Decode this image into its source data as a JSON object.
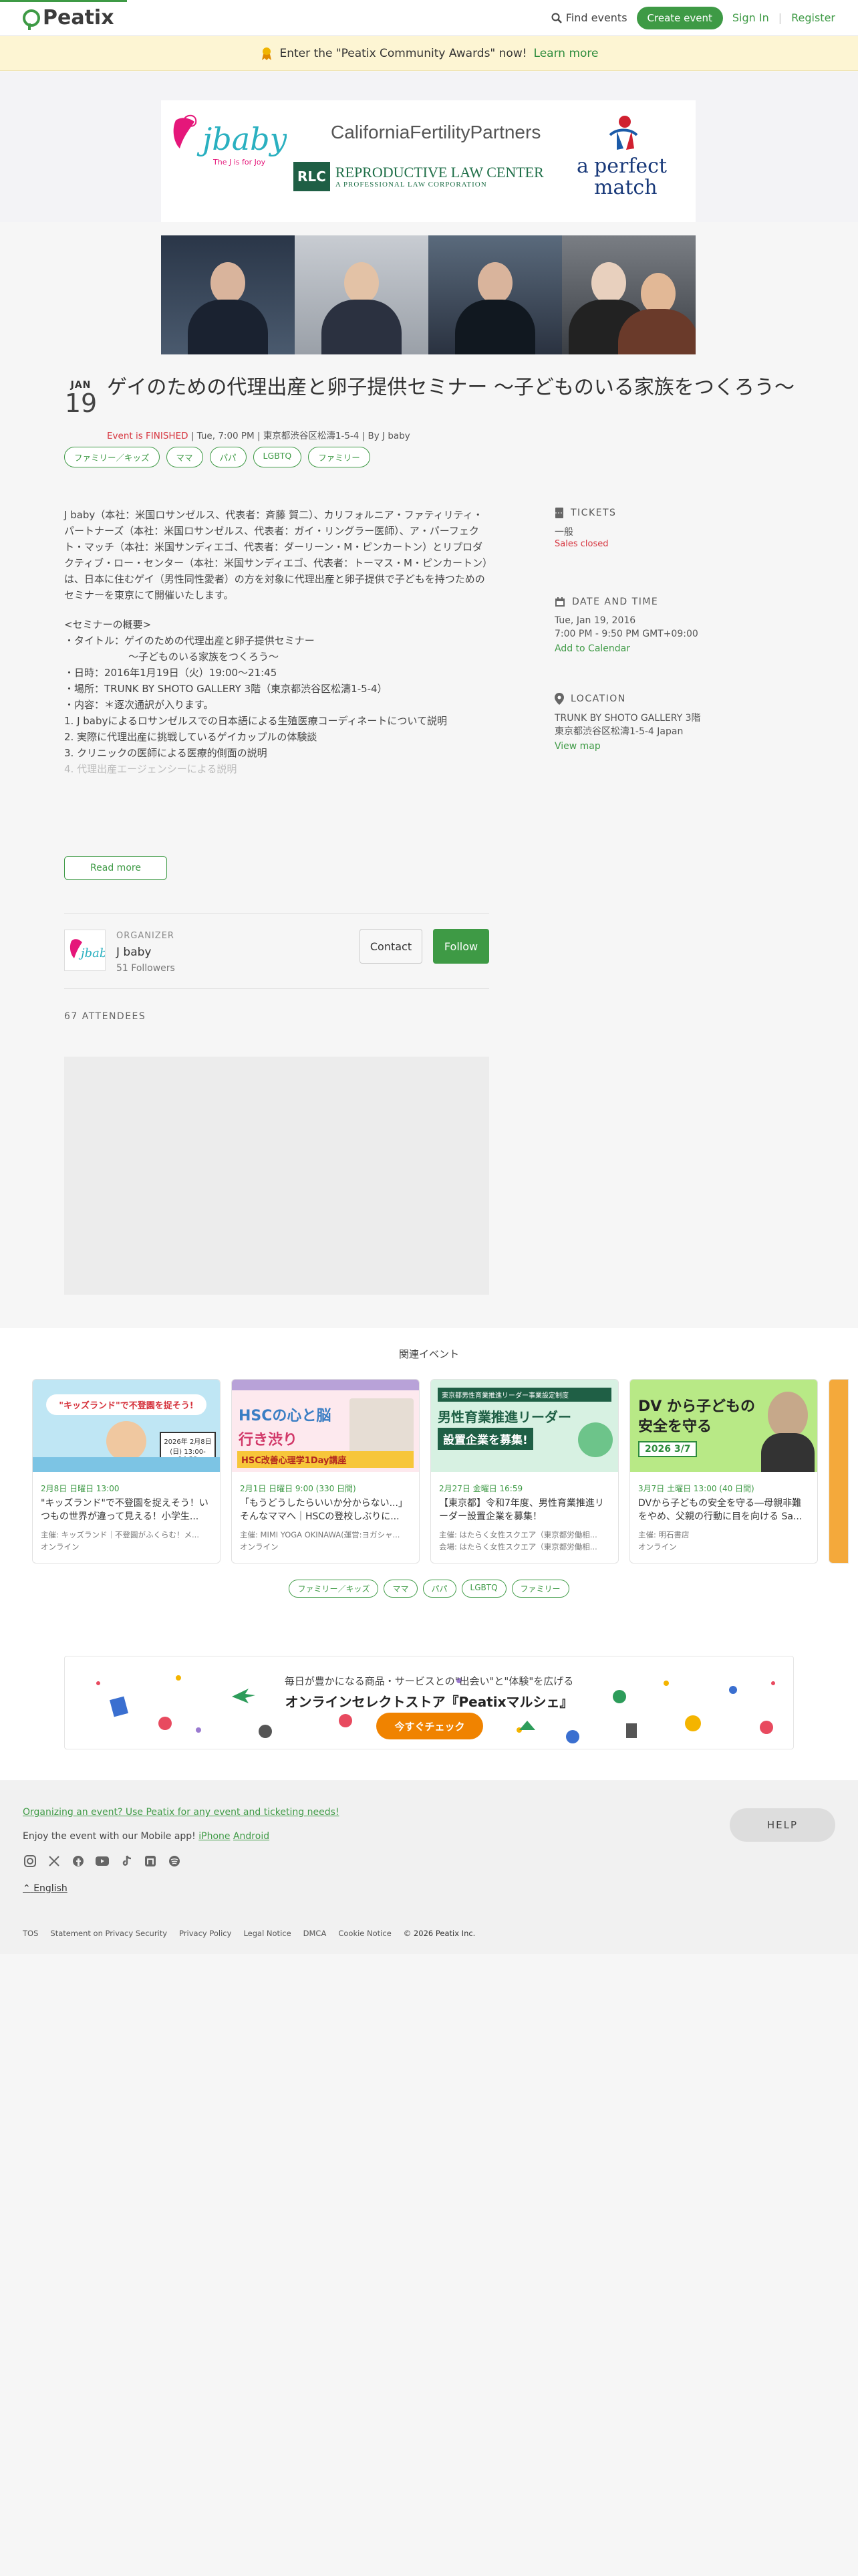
{
  "header": {
    "logo": "Peatix",
    "find_events": "Find events",
    "create_event": "Create event",
    "sign_in": "Sign In",
    "register": "Register",
    "separator": "|"
  },
  "banner": {
    "text": "Enter the \"Peatix Community Awards\" now!",
    "link": "Learn more"
  },
  "sponsors": {
    "jbaby": "jbaby",
    "jbaby_tagline": "The J is for Joy",
    "cfp": "CaliforniaFertilityPartners",
    "rlc_box": "RLC",
    "rlc_name": "REPRODUCTIVE LAW CENTER",
    "rlc_sub": "A PROFESSIONAL LAW CORPORATION",
    "pm_a": "a",
    "pm_name": "perfect",
    "pm_name2": "match"
  },
  "event": {
    "month": "JAN",
    "day": "19",
    "title": "ゲイのための代理出産と卵子提供セミナー 〜子どものいる家族をつくろう〜",
    "status": "Event is FINISHED",
    "datetime": "Tue, 7:00 PM",
    "place": "東京都渋谷区松濤1-5-4",
    "by": "By J baby",
    "sep": "|",
    "tags": [
      "ファミリー／キッズ",
      "ママ",
      "パパ",
      "LGBTQ",
      "ファミリー"
    ]
  },
  "description": {
    "p1": "J baby（本社：米国ロサンゼルス、代表者：斉藤 賀二）、カリフォルニア・ファティリティ・パートナーズ（本社：米国ロサンゼルス、代表者：ガイ・リングラー医師）、ア・パーフェクト・マッチ（本社：米国サンディエゴ、代表者：ダーリーン・M・ピンカートン）とリプロダクティブ・ロー・センター（本社：米国サンディエゴ、代表者：トーマス・M・ピンカートン）は、日本に住むゲイ（男性同性愛者）の方を対象に代理出産と卵子提供で子どもを持つためのセミナーを東京にて開催いたします。",
    "l0": "<セミナーの概要>",
    "l1": "・タイトル：ゲイのための代理出産と卵子提供セミナー",
    "l2": "〜子どものいる家族をつくろう〜",
    "l3": "・日時：2016年1月19日（火）19:00〜21:45",
    "l4": "・場所：TRUNK BY SHOTO GALLERY 3階（東京都渋谷区松濤1-5-4）",
    "l5": "・内容：＊逐次通訳が入ります。",
    "l6": "1. J babyによるロサンゼルスでの日本語による生殖医療コーディネートについて説明",
    "l7": "2. 実際に代理出産に挑戦しているゲイカップルの体験談",
    "l8": "3. クリニックの医師による医療的側面の説明",
    "l9": "4. 代理出産エージェンシーによる説明",
    "read_more": "Read more"
  },
  "organizer": {
    "label": "ORGANIZER",
    "name": "J baby",
    "followers": "51 Followers",
    "contact": "Contact",
    "follow": "Follow",
    "logo_text": "jbaby"
  },
  "attendees": "67 ATTENDEES",
  "sidebar": {
    "tickets_label": "TICKETS",
    "ticket_type": "一般",
    "ticket_status": "Sales closed",
    "dt_label": "DATE AND TIME",
    "dt_date": "Tue, Jan 19, 2016",
    "dt_time": "7:00 PM - 9:50 PM GMT+09:00",
    "add_calendar": "Add to Calendar",
    "loc_label": "LOCATION",
    "loc_name": "TRUNK BY SHOTO GALLERY 3階",
    "loc_addr": "東京都渋谷区松濤1-5-4 Japan",
    "view_map": "View map"
  },
  "related": {
    "title": "関連イベント",
    "cards": [
      {
        "date": "2月8日 日曜日 13:00",
        "title": "\"キッズランド\"で不登園を捉えそう！いつもの世界が違って見える！小学生...",
        "host": "主催: キッズランド｜不登園がふくらむ！メ...",
        "venue": "オンライン",
        "img_heading": "\"キッズランド\"で不登園を捉そう!",
        "img_date": "2026年 2月8日(日) 13:00-14:30"
      },
      {
        "date": "2月1日 日曜日 9:00 (330 日間)",
        "title": "「もうどうしたらいいか分からない...」そんなママへ｜HSCの登校しぶりに...",
        "host": "主催: MIMI YOGA OKINAWA(運営:ヨガシャ...",
        "venue": "オンライン",
        "img_heading": "HSCの心と脳",
        "img_sub": "行き渋り",
        "img_foot": "HSC改善心理学1Day講座"
      },
      {
        "date": "2月27日 金曜日 16:59",
        "title": "【東京都】令和7年度、男性育業推進リーダー設置企業を募集！",
        "host": "主催: はたらく女性スクエア（東京都労働相...",
        "venue": "会場: はたらく女性スクエア（東京都労働相...",
        "img_top": "東京都男性育業推進リーダー事業設定制度",
        "img_heading": "男性育業推進リーダー",
        "img_sub": "設置企業を募集!"
      },
      {
        "date": "3月7日 土曜日 13:00 (40 日間)",
        "title": "DVから子どもの安全を守る―母親非難をやめ、父親の行動に目を向ける Sa...",
        "host": "主催: 明石書店",
        "venue": "オンライン",
        "img_heading": "DV から子どもの",
        "img_heading2": "安全を守る",
        "img_date": "2026 3/7"
      }
    ],
    "tags": [
      "ファミリー／キッズ",
      "ママ",
      "パパ",
      "LGBTQ",
      "ファミリー"
    ]
  },
  "ad": {
    "line1": "毎日が豊かになる商品・サービスとの\"出会い\"と\"体験\"を広げる",
    "line2": "オンラインセレクトストア『Peatixマルシェ』",
    "cta": "今すぐチェック"
  },
  "footer": {
    "organizing": "Organizing an event? Use Peatix for any event and ticketing needs!",
    "app_text": "Enjoy the event with our Mobile app!",
    "iphone": "iPhone",
    "android": "Android",
    "language": "English",
    "help": "HELP",
    "links": [
      "TOS",
      "Statement on Privacy Security",
      "Privacy Policy",
      "Legal Notice",
      "DMCA",
      "Cookie Notice",
      "© 2026 Peatix Inc."
    ]
  },
  "colors": {
    "brand": "#3e9a45",
    "finished": "#d6333d",
    "banner_bg": "#fdf5d3",
    "cta": "#f08300"
  }
}
